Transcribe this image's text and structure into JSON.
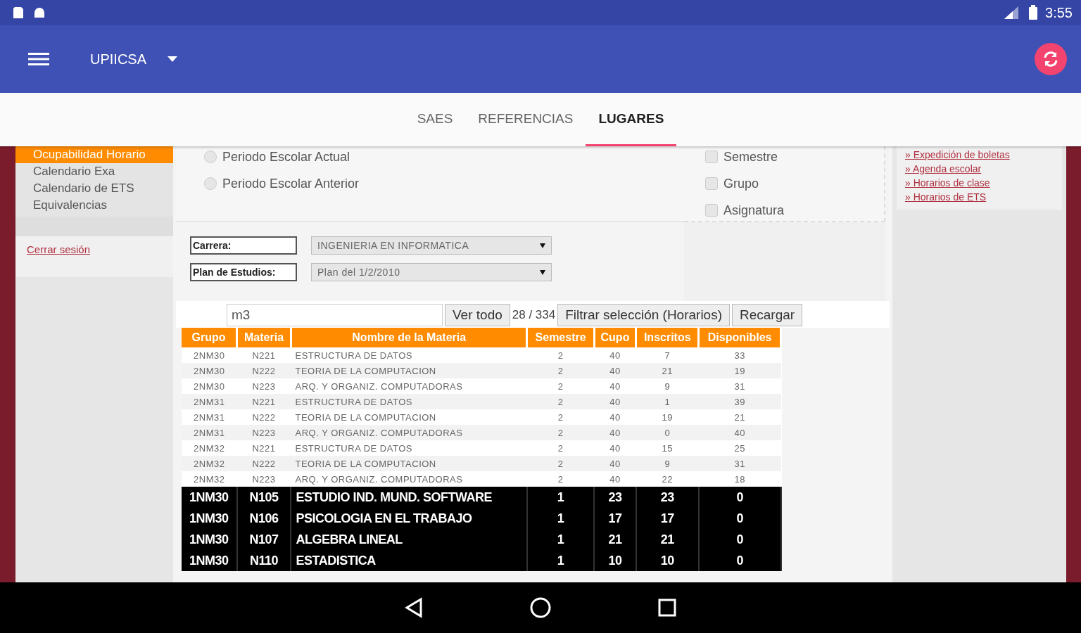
{
  "status_bar": {
    "time": "3:55"
  },
  "app_bar": {
    "title": "UPIICSA"
  },
  "tabs": [
    {
      "label": "SAES",
      "selected": false
    },
    {
      "label": "REFERENCIAS",
      "selected": false
    },
    {
      "label": "LUGARES",
      "selected": true
    }
  ],
  "sidebar": {
    "items": [
      {
        "label": "Ocupabilidad Horario",
        "selected": true
      },
      {
        "label": "Calendario Exa",
        "selected": false
      },
      {
        "label": "Calendario de ETS",
        "selected": false
      },
      {
        "label": "Equivalencias",
        "selected": false
      }
    ],
    "logout": "Cerrar sesión"
  },
  "period_options": [
    {
      "label": "Periodo Escolar Actual",
      "checked": false
    },
    {
      "label": "Periodo Escolar Anterior",
      "checked": false
    }
  ],
  "filter_options": [
    {
      "label": "Semestre",
      "checked": false
    },
    {
      "label": "Grupo",
      "checked": false
    },
    {
      "label": "Asignatura",
      "checked": false
    }
  ],
  "form": [
    {
      "label": "Carrera:",
      "value": "INGENIERIA EN INFORMATICA"
    },
    {
      "label": "Plan de Estudios:",
      "value": "Plan del 1/2/2010"
    }
  ],
  "search": {
    "value": "m3",
    "show_all": "Ver todo",
    "count": "28 / 334",
    "filter_button": "Filtrar selección (Horarios)",
    "reload_button": "Recargar"
  },
  "table": {
    "columns": [
      "Grupo",
      "Materia",
      "Nombre de la Materia",
      "Semestre",
      "Cupo",
      "Inscritos",
      "Disponibles"
    ],
    "rows": [
      {
        "highlighted": false,
        "cells": [
          "2NM30",
          "N221",
          "ESTRUCTURA DE DATOS",
          "2",
          "40",
          "7",
          "33"
        ]
      },
      {
        "highlighted": false,
        "cells": [
          "2NM30",
          "N222",
          "TEORIA DE LA COMPUTACION",
          "2",
          "40",
          "21",
          "19"
        ]
      },
      {
        "highlighted": false,
        "cells": [
          "2NM30",
          "N223",
          "ARQ. Y ORGANIZ. COMPUTADORAS",
          "2",
          "40",
          "9",
          "31"
        ]
      },
      {
        "highlighted": false,
        "cells": [
          "2NM31",
          "N221",
          "ESTRUCTURA DE DATOS",
          "2",
          "40",
          "1",
          "39"
        ]
      },
      {
        "highlighted": false,
        "cells": [
          "2NM31",
          "N222",
          "TEORIA DE LA COMPUTACION",
          "2",
          "40",
          "19",
          "21"
        ]
      },
      {
        "highlighted": false,
        "cells": [
          "2NM31",
          "N223",
          "ARQ. Y ORGANIZ. COMPUTADORAS",
          "2",
          "40",
          "0",
          "40"
        ]
      },
      {
        "highlighted": false,
        "cells": [
          "2NM32",
          "N221",
          "ESTRUCTURA DE DATOS",
          "2",
          "40",
          "15",
          "25"
        ]
      },
      {
        "highlighted": false,
        "cells": [
          "2NM32",
          "N222",
          "TEORIA DE LA COMPUTACION",
          "2",
          "40",
          "9",
          "31"
        ]
      },
      {
        "highlighted": false,
        "cells": [
          "2NM32",
          "N223",
          "ARQ. Y ORGANIZ. COMPUTADORAS",
          "2",
          "40",
          "22",
          "18"
        ]
      },
      {
        "highlighted": true,
        "cells": [
          "1NM30",
          "N105",
          "ESTUDIO IND. MUND. SOFTWARE",
          "1",
          "23",
          "23",
          "0"
        ]
      },
      {
        "highlighted": true,
        "cells": [
          "1NM30",
          "N106",
          "PSICOLOGIA EN EL TRABAJO",
          "1",
          "17",
          "17",
          "0"
        ]
      },
      {
        "highlighted": true,
        "cells": [
          "1NM30",
          "N107",
          "ALGEBRA LINEAL",
          "1",
          "21",
          "21",
          "0"
        ]
      },
      {
        "highlighted": true,
        "cells": [
          "1NM30",
          "N110",
          "ESTADISTICA",
          "1",
          "10",
          "10",
          "0"
        ]
      }
    ]
  },
  "links": [
    "» Expedición de boletas",
    "» Agenda escolar",
    "» Horarios de clase",
    "» Horarios de ETS"
  ]
}
